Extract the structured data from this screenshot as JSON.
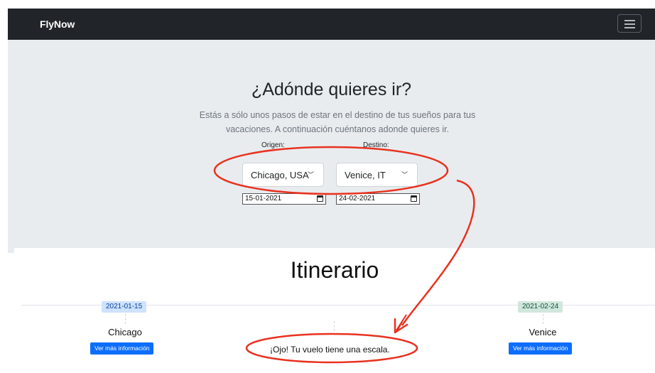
{
  "navbar": {
    "brand": "FlyNow",
    "menu_icon": "hamburger-menu-icon"
  },
  "hero": {
    "title": "¿Adónde quieres ir?",
    "lead_line1": "Estás a sólo unos pasos de estar en el destino de tus sueños para tus",
    "lead_line2": "vacaciones. A continuación cuéntanos adonde quieres ir.",
    "origin_label": "Origen:",
    "destination_label": "Destino:",
    "origin_value": "Chicago, USA",
    "destination_value": "Venice, IT",
    "departure_date": "15-01-2021",
    "return_date": "24-02-2021"
  },
  "itinerary": {
    "title": "Itinerario",
    "stops": [
      {
        "date": "2021-01-15",
        "city": "Chicago",
        "button": "Ver más información"
      },
      {
        "date": "2021-02-24",
        "city": "Venice",
        "button": "Ver más información"
      }
    ],
    "layover_notice": "¡Ojo! Tu vuelo tiene una escala."
  },
  "colors": {
    "navbar_bg": "#212529",
    "hero_bg": "#e9ecef",
    "primary": "#0d6efd",
    "annotation_red": "#e8321f",
    "badge_blue_bg": "#cfe2ff",
    "badge_green_bg": "#d1e7dd"
  }
}
